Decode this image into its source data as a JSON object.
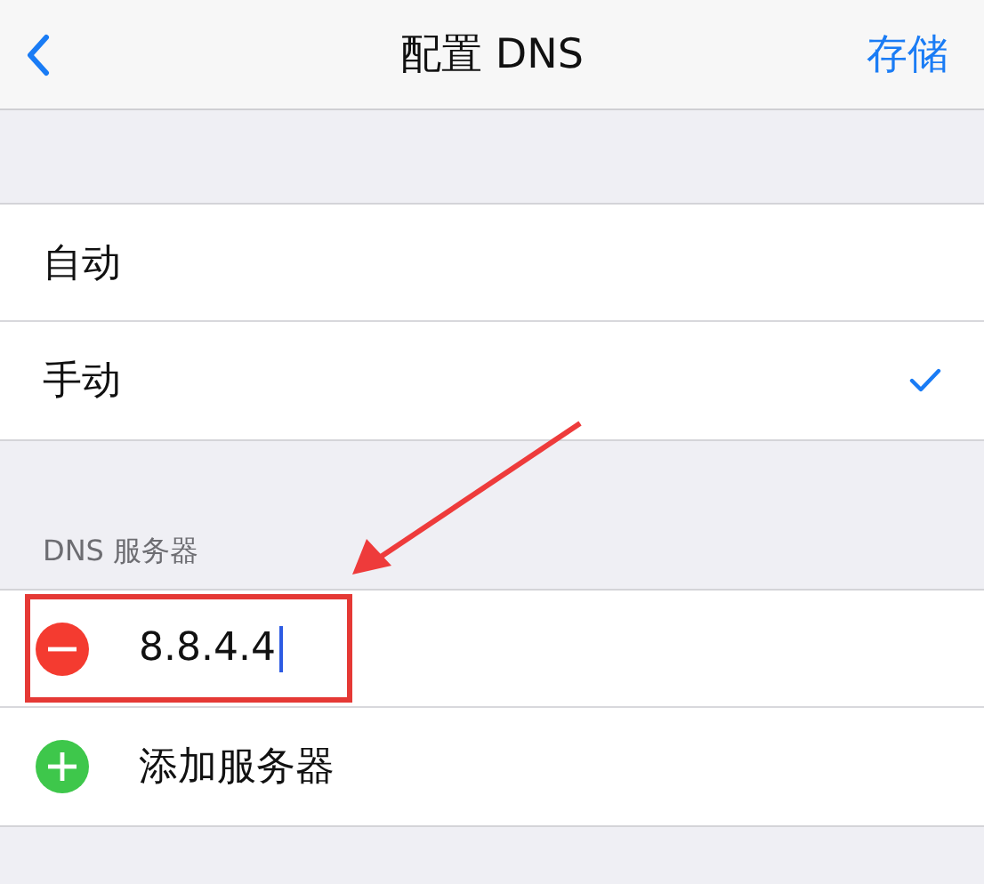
{
  "nav": {
    "title": "配置 DNS",
    "action": "存储"
  },
  "modes": [
    {
      "label": "自动",
      "selected": false
    },
    {
      "label": "手动",
      "selected": true
    }
  ],
  "section_header": "DNS 服务器",
  "servers": [
    {
      "kind": "remove",
      "text": "8.8.4.4",
      "focused": true,
      "highlighted": true
    },
    {
      "kind": "add",
      "text": "添加服务器",
      "focused": false,
      "highlighted": false
    }
  ]
}
